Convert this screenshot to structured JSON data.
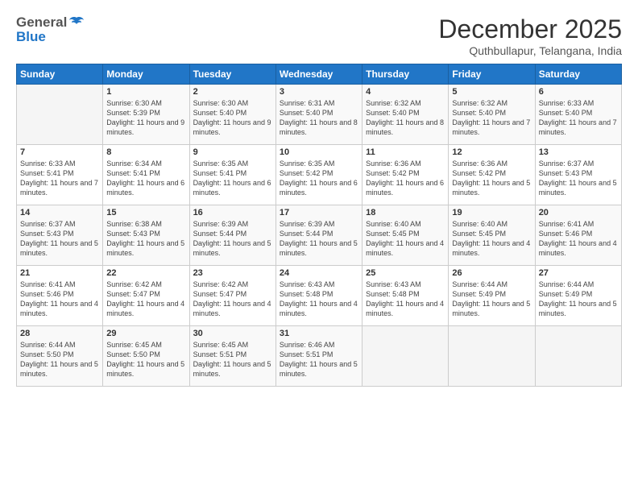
{
  "header": {
    "logo_general": "General",
    "logo_blue": "Blue",
    "month_title": "December 2025",
    "location": "Quthbullapur, Telangana, India"
  },
  "days_of_week": [
    "Sunday",
    "Monday",
    "Tuesday",
    "Wednesday",
    "Thursday",
    "Friday",
    "Saturday"
  ],
  "weeks": [
    [
      {
        "day": "",
        "sunrise": "",
        "sunset": "",
        "daylight": ""
      },
      {
        "day": "1",
        "sunrise": "Sunrise: 6:30 AM",
        "sunset": "Sunset: 5:39 PM",
        "daylight": "Daylight: 11 hours and 9 minutes."
      },
      {
        "day": "2",
        "sunrise": "Sunrise: 6:30 AM",
        "sunset": "Sunset: 5:40 PM",
        "daylight": "Daylight: 11 hours and 9 minutes."
      },
      {
        "day": "3",
        "sunrise": "Sunrise: 6:31 AM",
        "sunset": "Sunset: 5:40 PM",
        "daylight": "Daylight: 11 hours and 8 minutes."
      },
      {
        "day": "4",
        "sunrise": "Sunrise: 6:32 AM",
        "sunset": "Sunset: 5:40 PM",
        "daylight": "Daylight: 11 hours and 8 minutes."
      },
      {
        "day": "5",
        "sunrise": "Sunrise: 6:32 AM",
        "sunset": "Sunset: 5:40 PM",
        "daylight": "Daylight: 11 hours and 7 minutes."
      },
      {
        "day": "6",
        "sunrise": "Sunrise: 6:33 AM",
        "sunset": "Sunset: 5:40 PM",
        "daylight": "Daylight: 11 hours and 7 minutes."
      }
    ],
    [
      {
        "day": "7",
        "sunrise": "Sunrise: 6:33 AM",
        "sunset": "Sunset: 5:41 PM",
        "daylight": "Daylight: 11 hours and 7 minutes."
      },
      {
        "day": "8",
        "sunrise": "Sunrise: 6:34 AM",
        "sunset": "Sunset: 5:41 PM",
        "daylight": "Daylight: 11 hours and 6 minutes."
      },
      {
        "day": "9",
        "sunrise": "Sunrise: 6:35 AM",
        "sunset": "Sunset: 5:41 PM",
        "daylight": "Daylight: 11 hours and 6 minutes."
      },
      {
        "day": "10",
        "sunrise": "Sunrise: 6:35 AM",
        "sunset": "Sunset: 5:42 PM",
        "daylight": "Daylight: 11 hours and 6 minutes."
      },
      {
        "day": "11",
        "sunrise": "Sunrise: 6:36 AM",
        "sunset": "Sunset: 5:42 PM",
        "daylight": "Daylight: 11 hours and 6 minutes."
      },
      {
        "day": "12",
        "sunrise": "Sunrise: 6:36 AM",
        "sunset": "Sunset: 5:42 PM",
        "daylight": "Daylight: 11 hours and 5 minutes."
      },
      {
        "day": "13",
        "sunrise": "Sunrise: 6:37 AM",
        "sunset": "Sunset: 5:43 PM",
        "daylight": "Daylight: 11 hours and 5 minutes."
      }
    ],
    [
      {
        "day": "14",
        "sunrise": "Sunrise: 6:37 AM",
        "sunset": "Sunset: 5:43 PM",
        "daylight": "Daylight: 11 hours and 5 minutes."
      },
      {
        "day": "15",
        "sunrise": "Sunrise: 6:38 AM",
        "sunset": "Sunset: 5:43 PM",
        "daylight": "Daylight: 11 hours and 5 minutes."
      },
      {
        "day": "16",
        "sunrise": "Sunrise: 6:39 AM",
        "sunset": "Sunset: 5:44 PM",
        "daylight": "Daylight: 11 hours and 5 minutes."
      },
      {
        "day": "17",
        "sunrise": "Sunrise: 6:39 AM",
        "sunset": "Sunset: 5:44 PM",
        "daylight": "Daylight: 11 hours and 5 minutes."
      },
      {
        "day": "18",
        "sunrise": "Sunrise: 6:40 AM",
        "sunset": "Sunset: 5:45 PM",
        "daylight": "Daylight: 11 hours and 4 minutes."
      },
      {
        "day": "19",
        "sunrise": "Sunrise: 6:40 AM",
        "sunset": "Sunset: 5:45 PM",
        "daylight": "Daylight: 11 hours and 4 minutes."
      },
      {
        "day": "20",
        "sunrise": "Sunrise: 6:41 AM",
        "sunset": "Sunset: 5:46 PM",
        "daylight": "Daylight: 11 hours and 4 minutes."
      }
    ],
    [
      {
        "day": "21",
        "sunrise": "Sunrise: 6:41 AM",
        "sunset": "Sunset: 5:46 PM",
        "daylight": "Daylight: 11 hours and 4 minutes."
      },
      {
        "day": "22",
        "sunrise": "Sunrise: 6:42 AM",
        "sunset": "Sunset: 5:47 PM",
        "daylight": "Daylight: 11 hours and 4 minutes."
      },
      {
        "day": "23",
        "sunrise": "Sunrise: 6:42 AM",
        "sunset": "Sunset: 5:47 PM",
        "daylight": "Daylight: 11 hours and 4 minutes."
      },
      {
        "day": "24",
        "sunrise": "Sunrise: 6:43 AM",
        "sunset": "Sunset: 5:48 PM",
        "daylight": "Daylight: 11 hours and 4 minutes."
      },
      {
        "day": "25",
        "sunrise": "Sunrise: 6:43 AM",
        "sunset": "Sunset: 5:48 PM",
        "daylight": "Daylight: 11 hours and 4 minutes."
      },
      {
        "day": "26",
        "sunrise": "Sunrise: 6:44 AM",
        "sunset": "Sunset: 5:49 PM",
        "daylight": "Daylight: 11 hours and 5 minutes."
      },
      {
        "day": "27",
        "sunrise": "Sunrise: 6:44 AM",
        "sunset": "Sunset: 5:49 PM",
        "daylight": "Daylight: 11 hours and 5 minutes."
      }
    ],
    [
      {
        "day": "28",
        "sunrise": "Sunrise: 6:44 AM",
        "sunset": "Sunset: 5:50 PM",
        "daylight": "Daylight: 11 hours and 5 minutes."
      },
      {
        "day": "29",
        "sunrise": "Sunrise: 6:45 AM",
        "sunset": "Sunset: 5:50 PM",
        "daylight": "Daylight: 11 hours and 5 minutes."
      },
      {
        "day": "30",
        "sunrise": "Sunrise: 6:45 AM",
        "sunset": "Sunset: 5:51 PM",
        "daylight": "Daylight: 11 hours and 5 minutes."
      },
      {
        "day": "31",
        "sunrise": "Sunrise: 6:46 AM",
        "sunset": "Sunset: 5:51 PM",
        "daylight": "Daylight: 11 hours and 5 minutes."
      },
      {
        "day": "",
        "sunrise": "",
        "sunset": "",
        "daylight": ""
      },
      {
        "day": "",
        "sunrise": "",
        "sunset": "",
        "daylight": ""
      },
      {
        "day": "",
        "sunrise": "",
        "sunset": "",
        "daylight": ""
      }
    ]
  ]
}
